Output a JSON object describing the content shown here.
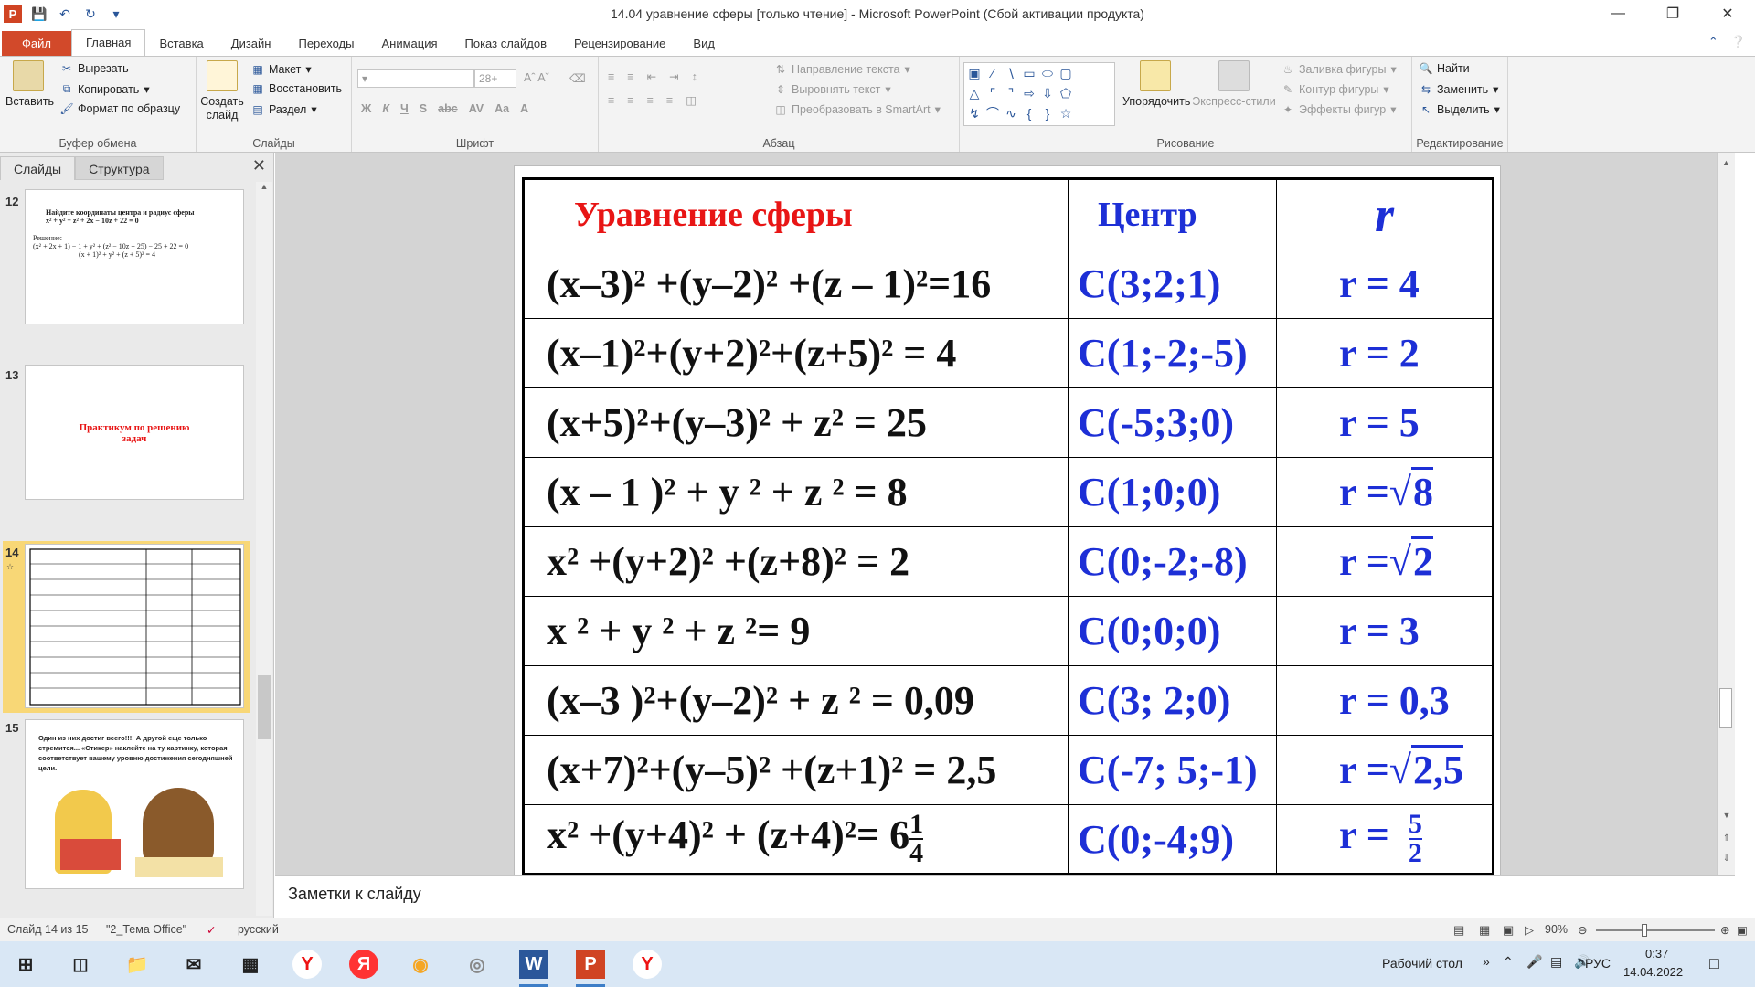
{
  "window": {
    "title": "14.04 уравнение сферы [только чтение]  -  Microsoft PowerPoint (Сбой активации продукта)",
    "app_logo": "P"
  },
  "ribbon_tabs": [
    "Файл",
    "Главная",
    "Вставка",
    "Дизайн",
    "Переходы",
    "Анимация",
    "Показ слайдов",
    "Рецензирование",
    "Вид"
  ],
  "ribbon": {
    "clipboard": {
      "paste": "Вставить",
      "cut": "Вырезать",
      "copy": "Копировать",
      "format_painter": "Формат по образцу",
      "label": "Буфер обмена"
    },
    "slides": {
      "new_slide": "Создать слайд",
      "layout": "Макет",
      "reset": "Восстановить",
      "section": "Раздел",
      "label": "Слайды"
    },
    "font": {
      "size": "28+",
      "label": "Шрифт"
    },
    "paragraph": {
      "text_direction": "Направление текста",
      "align_text": "Выровнять текст",
      "smartart": "Преобразовать в SmartArt",
      "label": "Абзац"
    },
    "drawing": {
      "arrange": "Упорядочить",
      "quick_styles": "Экспресс-стили",
      "fill": "Заливка фигуры",
      "outline": "Контур фигуры",
      "effects": "Эффекты фигур",
      "label": "Рисование"
    },
    "editing": {
      "find": "Найти",
      "replace": "Заменить",
      "select": "Выделить",
      "label": "Редактирование"
    }
  },
  "panel": {
    "tabs": [
      "Слайды",
      "Структура"
    ],
    "thumbnails": [
      {
        "num": "12",
        "title": "Найдите координаты центра и радиус сферы",
        "line1": "x² + y² + z² + 2x − 10z + 22 = 0",
        "line2": "Решение:",
        "line3": "(x² + 2x + 1) − 1 + y² + (z² − 10z + 25) − 25 + 22 = 0",
        "line4": "(x + 1)² + y² + (z + 5)² = 4"
      },
      {
        "num": "13",
        "title": "Практикум   по решению задач"
      },
      {
        "num": "14"
      },
      {
        "num": "15",
        "text": "Один из них  достиг всего!!!!   А другой  еще только стремится...  «Стикер» наклейте  на ту картинку, которая соответствует вашему  уровню достижения сегодняшней цели."
      }
    ]
  },
  "slide": {
    "headers": {
      "equation": "Уравнение сферы",
      "center": "Центр",
      "radius": "r"
    },
    "rows": [
      {
        "eq": "(x–3)² +(y–2)² +(z – 1)²=16",
        "center": "C(3;2;1)",
        "r": "r = 4"
      },
      {
        "eq": "(x–1)²+(y+2)²+(z+5)² = 4",
        "center": "C(1;-2;-5)",
        "r": "r = 2"
      },
      {
        "eq": "(x+5)²+(y–3)² + z² = 25",
        "center": "C(-5;3;0)",
        "r": "r = 5"
      },
      {
        "eq": "(x – 1 )² + y ² + z ² = 8",
        "center": "C(1;0;0)",
        "r_prefix": "r =",
        "r_root": "8"
      },
      {
        "eq": "x² +(y+2)² +(z+8)² = 2",
        "center": "C(0;-2;-8)",
        "r_prefix": "r =",
        "r_root": "2"
      },
      {
        "eq": "x ² + y ² + z ²= 9",
        "center": "C(0;0;0)",
        "r": "r = 3"
      },
      {
        "eq": "(x–3 )²+(y–2)² + z ² = 0,09",
        "center": "C(3; 2;0)",
        "r": "r = 0,3"
      },
      {
        "eq": "(x+7)²+(y–5)² +(z+1)² = 2,5",
        "center": "C(-7; 5;-1)",
        "r_prefix": "r =",
        "r_root": "2,5"
      },
      {
        "eq": "x² +(y+4)² + (z+4)²= 6",
        "eq_frac_num": "1",
        "eq_frac_den": "4",
        "center": "C(0;-4;9)",
        "r_prefix": "r = ",
        "r_frac_num": "5",
        "r_frac_den": "2"
      }
    ]
  },
  "notes_placeholder": "Заметки к слайду",
  "status": {
    "slide_info": "Слайд 14 из 15",
    "theme": "\"2_Тема Office\"",
    "language": "русский",
    "zoom": "90%"
  },
  "taskbar": {
    "desktop": "Рабочий стол",
    "lang": "РУС",
    "time": "0:37",
    "date": "14.04.2022"
  },
  "colors": {
    "file_tab": "#d2492a",
    "blue_text": "#1d2fd6",
    "red_text": "#e81515",
    "selection": "#f5cb5c"
  }
}
